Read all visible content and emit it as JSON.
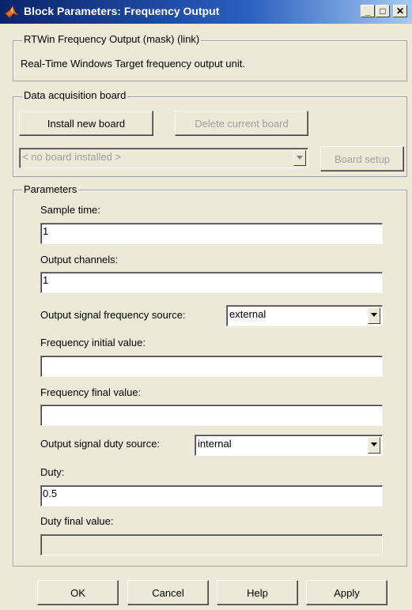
{
  "window": {
    "title": "Block Parameters: Frequency Output",
    "minimize_glyph": "_",
    "maximize_glyph": "□",
    "close_glyph": "✕"
  },
  "description_group": {
    "legend": "RTWin Frequency Output (mask) (link)",
    "text": "Real-Time Windows Target frequency output unit."
  },
  "daq_group": {
    "legend": "Data acquisition board",
    "install_label": "Install new board",
    "delete_label": "Delete current board",
    "board_select_value": "< no board installed >",
    "board_setup_label": "Board setup"
  },
  "params_group": {
    "legend": "Parameters",
    "sample_time_label": "Sample time:",
    "sample_time_value": "1",
    "output_channels_label": "Output channels:",
    "output_channels_value": "1",
    "freq_source_label": "Output signal frequency source:",
    "freq_source_value": "external",
    "freq_initial_label": "Frequency initial value:",
    "freq_initial_value": "",
    "freq_final_label": "Frequency final value:",
    "freq_final_value": "",
    "duty_source_label": "Output signal duty source:",
    "duty_source_value": "internal",
    "duty_label": "Duty:",
    "duty_value": "0.5",
    "duty_final_label": "Duty final value:",
    "duty_final_value": ""
  },
  "footer": {
    "ok_label": "OK",
    "cancel_label": "Cancel",
    "help_label": "Help",
    "apply_label": "Apply"
  },
  "icons": {
    "window_icon": "matlab-logo-icon",
    "dropdown_arrow": "chevron-down-icon"
  }
}
